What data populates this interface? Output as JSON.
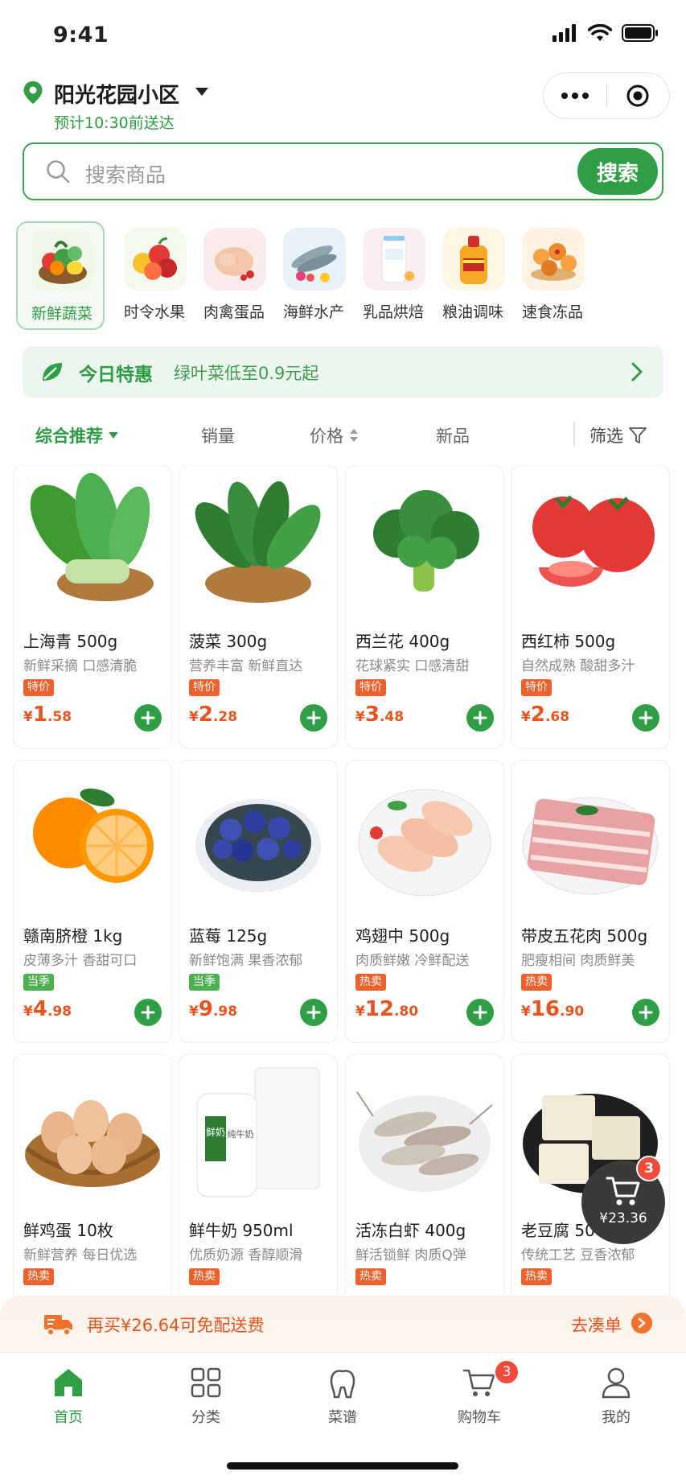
{
  "status_bar": {
    "time": "9:41"
  },
  "header": {
    "location": "阳光花园小区",
    "eta": "预计10:30前送达"
  },
  "search": {
    "placeholder": "搜索商品",
    "button": "搜索"
  },
  "categories": [
    {
      "label": "新鲜蔬菜",
      "icon": "vegetables-icon",
      "active": true
    },
    {
      "label": "时令水果",
      "icon": "fruits-icon"
    },
    {
      "label": "肉禽蛋品",
      "icon": "poultry-icon"
    },
    {
      "label": "海鲜水产",
      "icon": "seafood-icon"
    },
    {
      "label": "乳品烘焙",
      "icon": "dairy-icon"
    },
    {
      "label": "粮油调味",
      "icon": "oil-icon"
    },
    {
      "label": "速食冻品",
      "icon": "frozen-food-icon"
    }
  ],
  "promo": {
    "title": "今日特惠",
    "subtitle": "绿叶菜低至0.9元起"
  },
  "sort": {
    "comprehensive": "综合推荐",
    "sales": "销量",
    "price": "价格",
    "new": "新品",
    "filter": "筛选"
  },
  "products": [
    {
      "name": "上海青 500g",
      "desc": "新鲜采摘 口感清脆",
      "tag": "特价",
      "currency": "¥",
      "price_int": "1",
      "price_dec": ".58",
      "image": "bok-choy"
    },
    {
      "name": "菠菜 300g",
      "desc": "营养丰富 新鲜直达",
      "tag": "特价",
      "currency": "¥",
      "price_int": "2",
      "price_dec": ".28",
      "image": "spinach"
    },
    {
      "name": "西兰花 400g",
      "desc": "花球紧实 口感清甜",
      "tag": "特价",
      "currency": "¥",
      "price_int": "3",
      "price_dec": ".48",
      "image": "broccoli"
    },
    {
      "name": "西红柿 500g",
      "desc": "自然成熟 酸甜多汁",
      "tag": "特价",
      "currency": "¥",
      "price_int": "2",
      "price_dec": ".68",
      "image": "tomato"
    },
    {
      "name": "赣南脐橙 1kg",
      "desc": "皮薄多汁 香甜可口",
      "tag": "当季",
      "currency": "¥",
      "price_int": "4",
      "price_dec": ".98",
      "image": "orange"
    },
    {
      "name": "蓝莓 125g",
      "desc": "新鲜饱满 果香浓郁",
      "tag": "当季",
      "currency": "¥",
      "price_int": "9",
      "price_dec": ".98",
      "image": "blueberry"
    },
    {
      "name": "鸡翅中 500g",
      "desc": "肉质鲜嫩 冷鲜配送",
      "tag": "热卖",
      "currency": "¥",
      "price_int": "12",
      "price_dec": ".80",
      "image": "chicken-wings"
    },
    {
      "name": "带皮五花肉 500g",
      "desc": "肥瘦相间 肉质鲜美",
      "tag": "热卖",
      "currency": "¥",
      "price_int": "16",
      "price_dec": ".90",
      "image": "pork-belly"
    },
    {
      "name": "鲜鸡蛋 10枚",
      "desc": "新鲜营养 每日优选",
      "tag": "热卖",
      "image": "eggs"
    },
    {
      "name": "鲜牛奶 950ml",
      "desc": "优质奶源 香醇顺滑",
      "tag": "热卖",
      "image": "milk",
      "milk_label_1": "鲜奶",
      "milk_label_2": "纯牛奶"
    },
    {
      "name": "活冻白虾 400g",
      "desc": "鲜活锁鲜 肉质Q弹",
      "tag": "热卖",
      "image": "shrimp"
    },
    {
      "name": "老豆腐 500g",
      "desc": "传统工艺 豆香浓郁",
      "tag": "热卖",
      "image": "tofu"
    }
  ],
  "colors": {
    "primary": "#2f9e44",
    "price": "#e8541f",
    "tag_special": "#f0602a",
    "tag_season": "#4caf50",
    "tag_hot": "#f0602a"
  },
  "floating_cart": {
    "count": "3",
    "total": "¥23.36"
  },
  "shipping": {
    "text": "再买¥26.64可免配送费",
    "link": "去凑单"
  },
  "tabbar": [
    {
      "label": "首页",
      "icon": "home-icon",
      "active": true
    },
    {
      "label": "分类",
      "icon": "grid-icon"
    },
    {
      "label": "菜谱",
      "icon": "recipe-icon"
    },
    {
      "label": "购物车",
      "icon": "cart-icon",
      "badge": "3"
    },
    {
      "label": "我的",
      "icon": "user-icon"
    }
  ]
}
